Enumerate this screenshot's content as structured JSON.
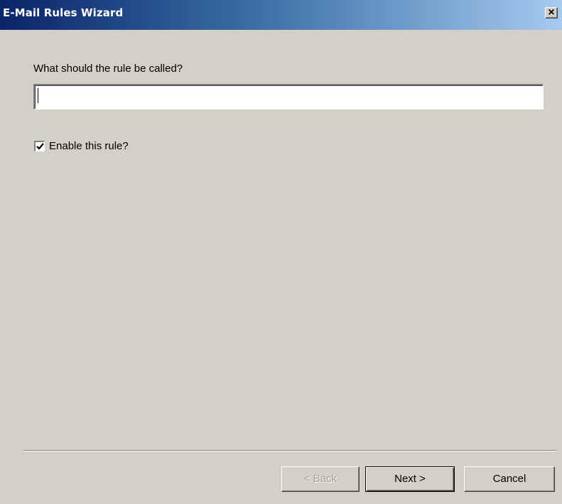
{
  "window": {
    "title": "E-Mail Rules Wizard"
  },
  "titlebar": {
    "close_glyph": "×",
    "close_icon": "close-icon"
  },
  "form": {
    "prompt_label": "What should the rule be called?",
    "name_value": "",
    "enable_label": "Enable this rule?",
    "enable_checked": true
  },
  "buttons": {
    "back_label": "< Back",
    "next_label": "Next >",
    "cancel_label": "Cancel",
    "back_enabled": false
  },
  "colors": {
    "face": "#d4d0c8",
    "title_dark": "#0a246a",
    "title_light": "#a6caf0",
    "disabled_text": "#a0a0a0"
  }
}
